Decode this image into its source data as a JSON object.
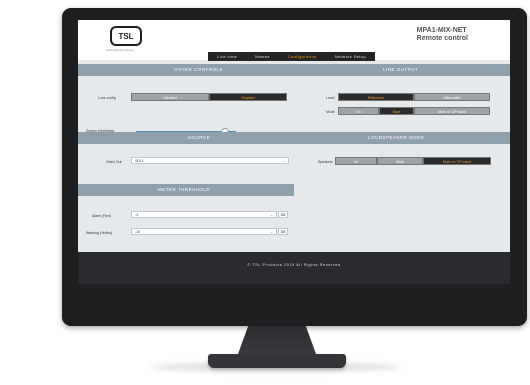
{
  "header": {
    "logo_text": "TSL",
    "logo_subtitle": "Audio Service Group",
    "device_name": "MPA1-MIX-NET",
    "subtitle": "Remote control"
  },
  "nav": {
    "tabs": [
      {
        "label": "Live view"
      },
      {
        "label": "Names"
      },
      {
        "label": "Configuration",
        "active": true
      },
      {
        "label": "Network Setup"
      }
    ]
  },
  "other_controls": {
    "title": "OTHER CONTROLS",
    "lock_config_label": "Lock config",
    "lock_options": [
      "Disabled",
      "Enabled"
    ],
    "lock_selected": "Enabled",
    "screen_brightness_label": "Screen brightness",
    "screen_brightness": 0.88
  },
  "line_output": {
    "title": "LINE OUTPUT",
    "level_label": "Level",
    "level_options": [
      "Reference",
      "Attenuated"
    ],
    "level_selected": "Reference",
    "mode_label": "Mode",
    "mode_options": [
      "On",
      "Mute",
      "Mute on T/P insert"
    ],
    "mode_selected": "Mute"
  },
  "source": {
    "title": "SOURCE",
    "video_out_label": "Video Out",
    "video_out_value": "SDI 1"
  },
  "loudspeaker_mode": {
    "title": "LOUDSPEAKER MODE",
    "speakers_label": "Speakers",
    "options": [
      "On",
      "Mute",
      "Mute on T/P insert"
    ],
    "selected": "Mute on T/P insert"
  },
  "meter_threshold": {
    "title": "METER THRESHOLD",
    "alarm_label": "Alarm (Red)",
    "alarm_value": "-3",
    "warning_label": "Warning (Yellow)",
    "warning_value": "-10",
    "unit": "DB"
  },
  "footer": {
    "text": "© TSL Products 2019 All Rights Reserved"
  },
  "colors": {
    "accent": "#f59a23",
    "band": "#8fa0ad",
    "slider": "#4c8fb7"
  }
}
